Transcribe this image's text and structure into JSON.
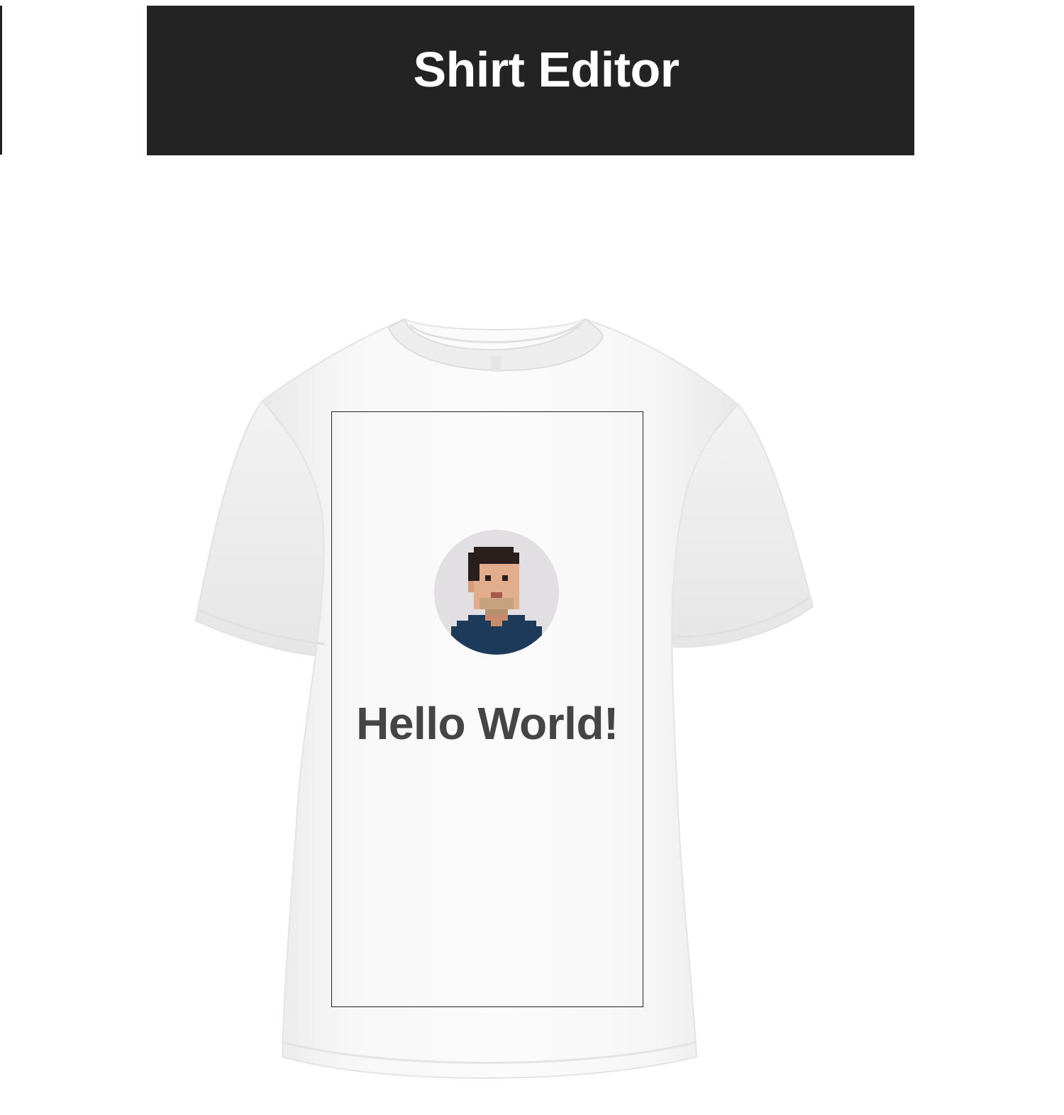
{
  "header": {
    "title": "Shirt Editor"
  },
  "shirt": {
    "color": "#f4f4f4",
    "print_text": "Hello World!",
    "print_text_color": "#454545",
    "avatar_icon": "pixel-avatar-icon"
  },
  "colors": {
    "header_bg": "#232323",
    "header_text": "#ffffff",
    "print_area_border": "#222222"
  }
}
